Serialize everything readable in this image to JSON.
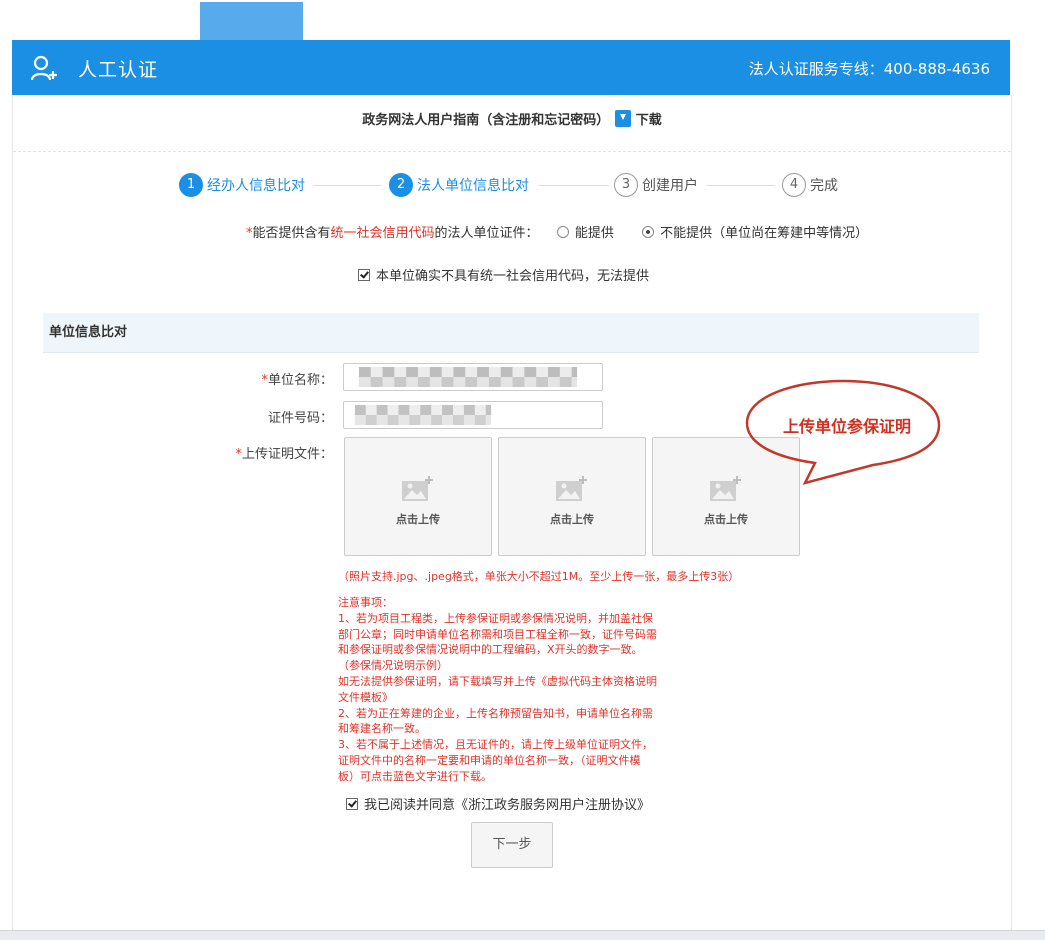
{
  "header": {
    "title": "人工认证",
    "hotline": "法人认证服务专线：400-888-4636"
  },
  "guide": {
    "text": "政务网法人用户指南（含注册和忘记密码）",
    "download_label": "下载"
  },
  "steps": [
    {
      "num": "1",
      "label": "经办人信息比对",
      "state": "active"
    },
    {
      "num": "2",
      "label": "法人单位信息比对",
      "state": "active"
    },
    {
      "num": "3",
      "label": "创建用户",
      "state": "todo"
    },
    {
      "num": "4",
      "label": "完成",
      "state": "todo"
    }
  ],
  "question": {
    "star": "*",
    "prefix": "能否提供含有",
    "highlight": "统一社会信用代码",
    "suffix": "的法人单位证件：",
    "option_yes": "能提供",
    "option_no": "不能提供（单位尚在筹建中等情况）",
    "selected": "no"
  },
  "no_code_checkbox": {
    "label": "本单位确实不具有统一社会信用代码，无法提供",
    "checked": true
  },
  "section": {
    "title": "单位信息比对"
  },
  "form": {
    "unit_name_label": "单位名称：",
    "cert_no_label": "证件号码：",
    "upload_label": "上传证明文件：",
    "star": "*"
  },
  "uploads": [
    {
      "label": "点击上传"
    },
    {
      "label": "点击上传"
    },
    {
      "label": "点击上传"
    }
  ],
  "callout": {
    "text": "上传单位参保证明"
  },
  "format_note": "（照片支持.jpg、.jpeg格式，单张大小不超过1M。至少上传一张，最多上传3张）",
  "notes": {
    "lines": [
      "注意事项：",
      "1、若为项目工程类，上传参保证明或参保情况说明，并加盖社保",
      "部门公章；同时申请单位名称需和项目工程全称一致，证件号码需",
      "和参保证明或参保情况说明中的工程编码，X开头的数字一致。",
      "（参保情况说明示例）",
      "如无法提供参保证明，请下载填写并上传《虚拟代码主体资格说明",
      "文件模板》",
      "2、若为正在筹建的企业，上传名称预留告知书，申请单位名称需",
      "和筹建名称一致。",
      "3、若不属于上述情况，且无证件的，请上传上级单位证明文件，",
      "证明文件中的名称一定要和申请的单位名称一致，（证明文件模",
      "板）可点击蓝色文字进行下载。"
    ]
  },
  "agreement": {
    "label": "我已阅读并同意《浙江政务服务网用户注册协议》",
    "checked": true
  },
  "next_button": "下一步",
  "colors": {
    "primary": "#1a8fe3",
    "error": "#e0332a",
    "callout": "#c0392b"
  }
}
